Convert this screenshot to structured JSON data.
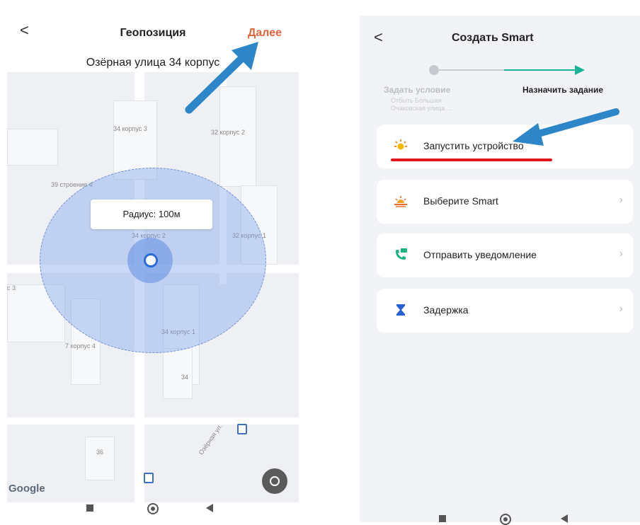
{
  "left_screen": {
    "title": "Геопозиция",
    "back_glyph": "<",
    "next_label": "Далее",
    "address": "Озёрная улица 34 корпус",
    "map": {
      "radius_label": "Радиус: 100м",
      "google_label": "Google",
      "labels": [
        "34 корпус 3",
        "32 корпус 2",
        "39 строение 4",
        "34 корпус 2",
        "32 корпус 1",
        "с 3",
        "34 корпус 1",
        "7 корпус 4",
        "34",
        "36",
        "Озёрная ул."
      ]
    }
  },
  "right_screen": {
    "title": "Создать Smart",
    "back_glyph": "<",
    "step1_label": "Задать условие",
    "step1_sub": "Отбыть Большая Очаковская улица ...",
    "step2_label": "Назначить задание",
    "cards": [
      {
        "label": "Запустить устройство",
        "icon": "sun-icon"
      },
      {
        "label": "Выберите Smart",
        "icon": "sunrise-icon"
      },
      {
        "label": "Отправить уведомление",
        "icon": "phone-message-icon"
      },
      {
        "label": "Задержка",
        "icon": "hourglass-icon"
      }
    ]
  },
  "colors": {
    "accent_orange": "#e0643c",
    "teal": "#1ab394",
    "annotation_blue": "#2d86c8",
    "underline_red": "#e0191f"
  }
}
